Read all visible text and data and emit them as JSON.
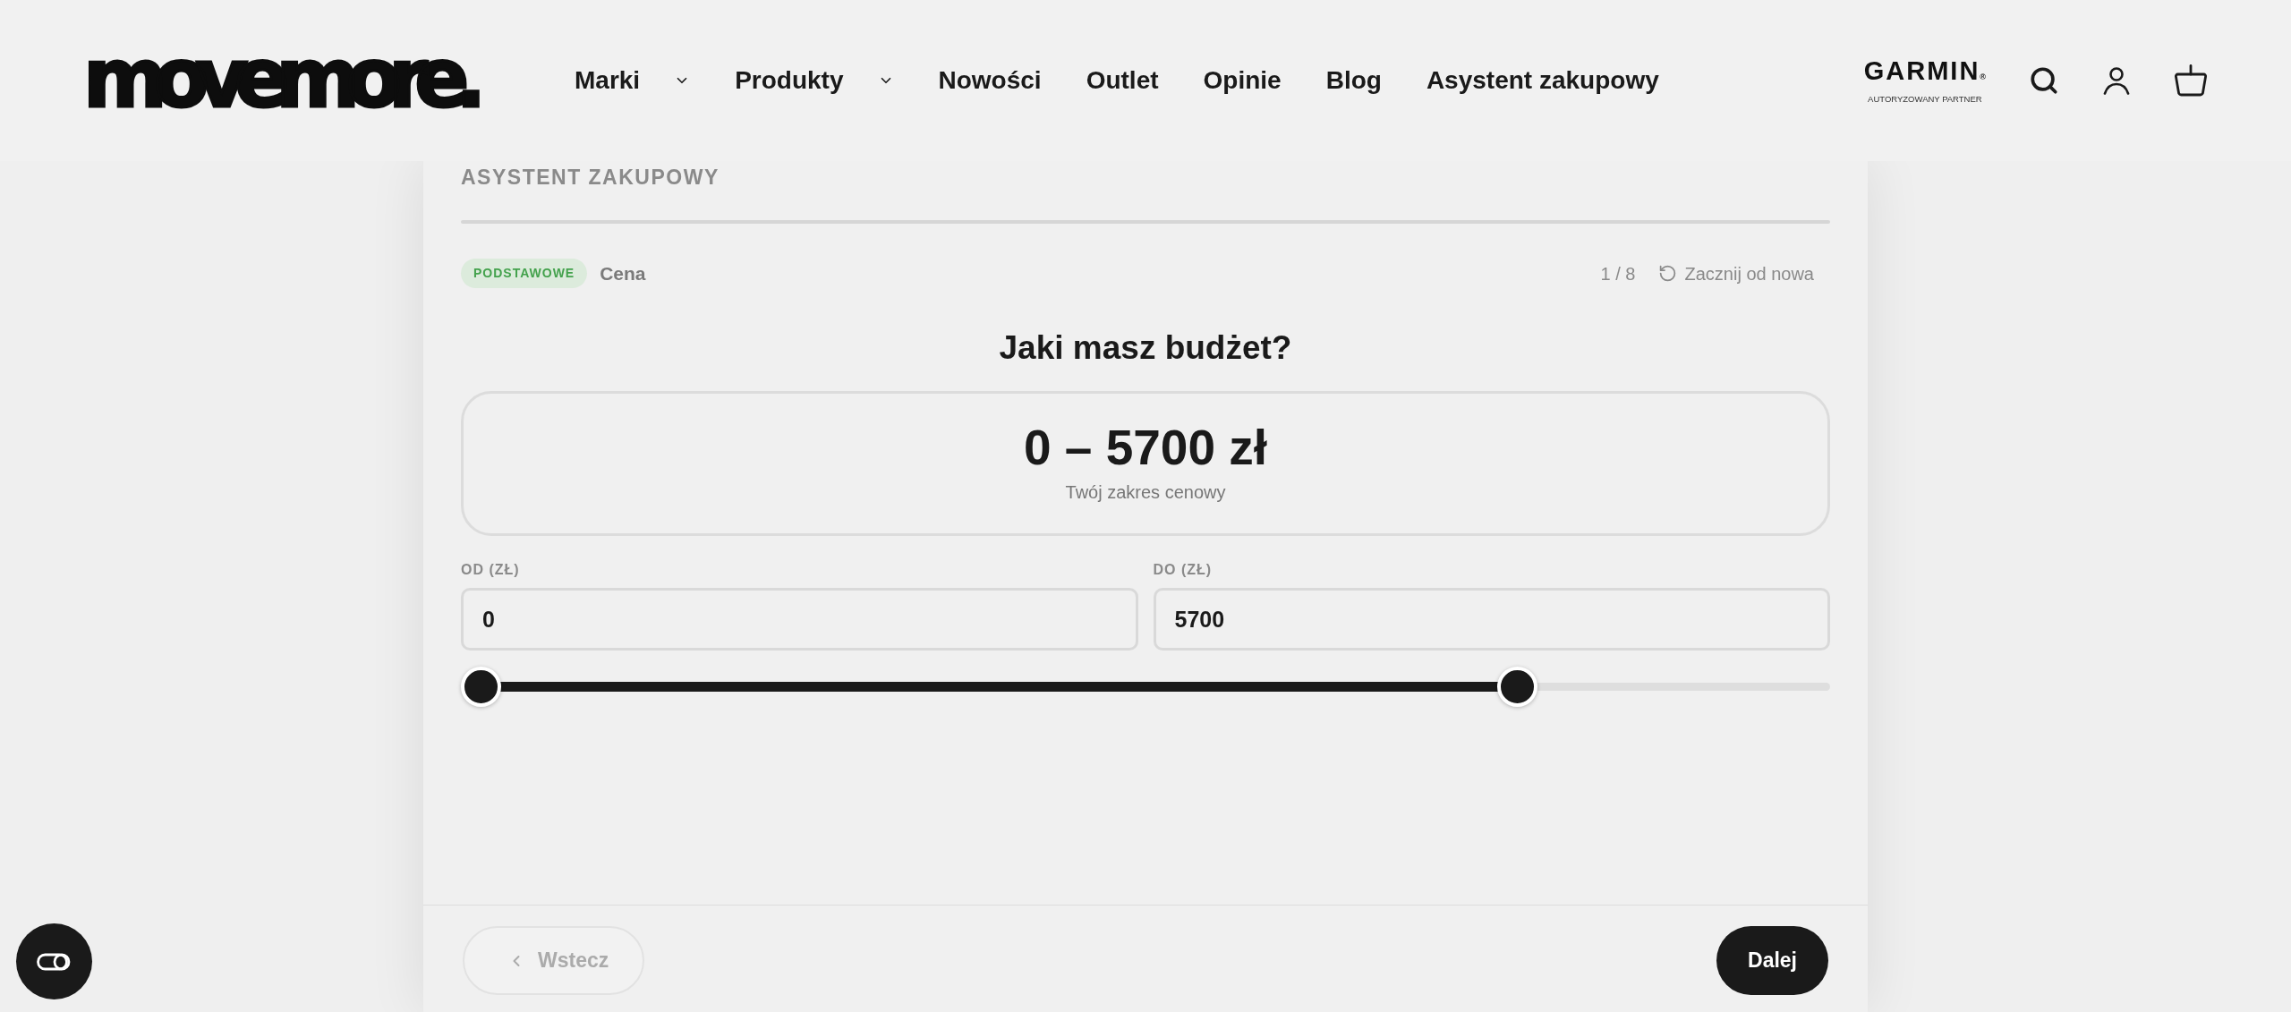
{
  "header": {
    "logo": "movemore.",
    "nav": [
      {
        "label": "Marki",
        "dropdown": true
      },
      {
        "label": "Produkty",
        "dropdown": true
      },
      {
        "label": "Nowości",
        "dropdown": false
      },
      {
        "label": "Outlet",
        "dropdown": false
      },
      {
        "label": "Opinie",
        "dropdown": false
      },
      {
        "label": "Blog",
        "dropdown": false
      },
      {
        "label": "Asystent zakupowy",
        "dropdown": false
      }
    ],
    "partner": {
      "brand": "GARMIN",
      "mark": "®",
      "caption": "AUTORYZOWANY PARTNER"
    }
  },
  "assistant": {
    "heading": "ASYSTENT ZAKUPOWY",
    "badge": "PODSTAWOWE",
    "step_name": "Cena",
    "step_counter": "1 / 8",
    "restart": "Zacznij od nowa",
    "question": "Jaki masz budżet?",
    "range_summary": {
      "value": "0 – 5700 zł",
      "caption": "Twój zakres cenowy"
    },
    "fields": [
      {
        "label": "OD (ZŁ)",
        "value": "0"
      },
      {
        "label": "DO (ZŁ)",
        "value": "5700"
      }
    ],
    "slider": {
      "low": {
        "level": 0
      },
      "high": {
        "level": 0.78
      }
    },
    "back_button": {
      "label": "Wstecz",
      "disabled": true
    },
    "next_button": {
      "label": "Dalej",
      "disabled": false
    }
  }
}
